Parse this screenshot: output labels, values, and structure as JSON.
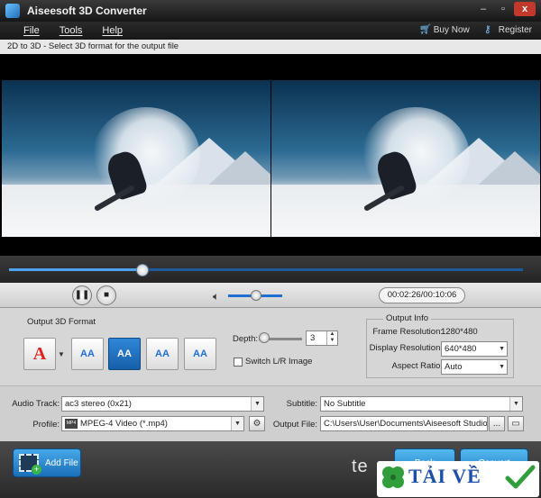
{
  "window": {
    "title": "Aiseesoft 3D Converter",
    "minimize": "–",
    "maximize": "▫",
    "close": "x"
  },
  "menu": {
    "items": [
      "File",
      "Tools",
      "Help"
    ],
    "buy_now": "Buy Now",
    "register": "Register"
  },
  "instruction": "2D to 3D - Select 3D format for the output file",
  "player": {
    "progress": 0.26,
    "time": "00:02:26/00:10:06",
    "volume": 0.5
  },
  "format": {
    "label": "Output 3D Format",
    "buttons": [
      "A",
      "AA",
      "AA",
      "AA",
      "AA"
    ],
    "selected_index": 2,
    "depth_label": "Depth:",
    "depth_value": "3",
    "switch_label": "Switch L/R Image"
  },
  "output_info": {
    "title": "Output Info",
    "frame_res_label": "Frame Resolution:",
    "frame_res_value": "1280*480",
    "display_res_label": "Display Resolution:",
    "display_res_value": "640*480",
    "aspect_label": "Aspect Ratio:",
    "aspect_value": "Auto"
  },
  "audio": {
    "audio_track_label": "Audio Track:",
    "audio_track_value": "ac3 stereo (0x21)",
    "subtitle_label": "Subtitle:",
    "subtitle_value": "No Subtitle",
    "profile_label": "Profile:",
    "profile_value": "MPEG-4 Video (*.mp4)",
    "output_file_label": "Output File:",
    "output_file_value": "C:\\Users\\User\\Documents\\Aiseesoft Studio\\Video",
    "more_btn": "...",
    "folder_btn": "▭"
  },
  "bottom": {
    "add_file": "Add File",
    "back": "Back",
    "convert": "Convert"
  },
  "watermark": {
    "text": "TẢI VỀ",
    "partial": "te"
  },
  "colors": {
    "accent": "#1e6fd1",
    "title_bg": "#161616",
    "panel_bg": "#d6d6d6"
  }
}
